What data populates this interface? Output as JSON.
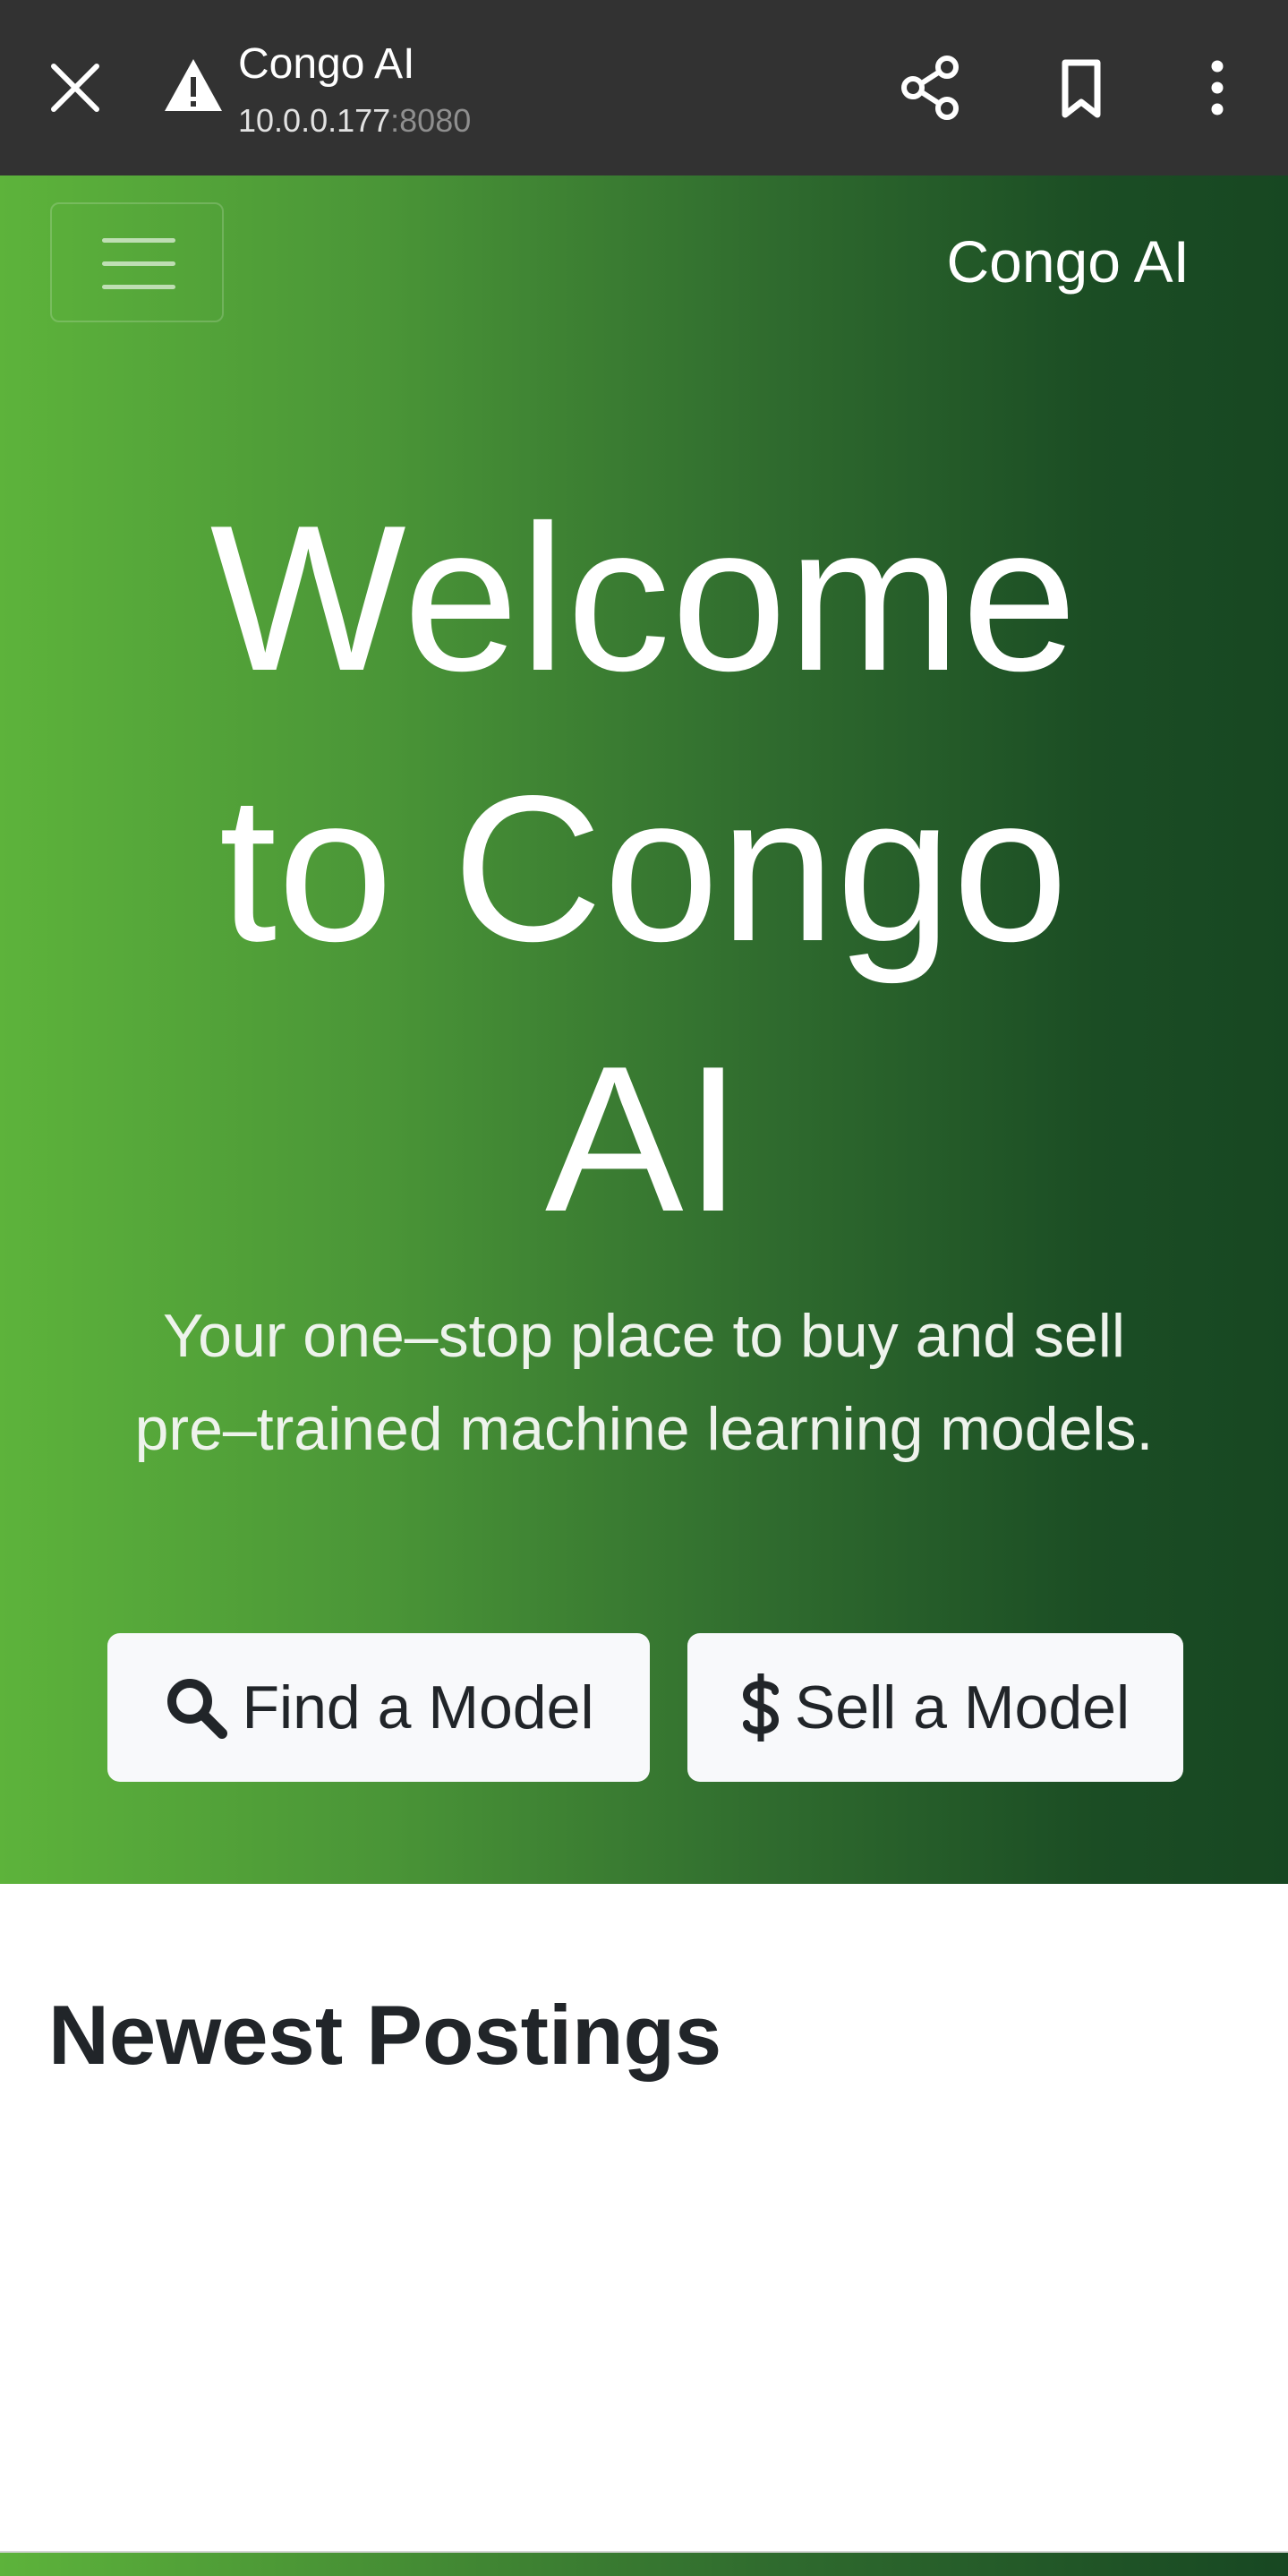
{
  "browser": {
    "tab_title": "Congo AI",
    "url_host": "10.0.0.177",
    "url_port": ":8080",
    "icons": [
      "close-icon",
      "warning-icon",
      "share-icon",
      "bookmark-icon",
      "more-vert-icon"
    ]
  },
  "navbar": {
    "brand": "Congo AI",
    "menu_icon": "hamburger-icon"
  },
  "hero": {
    "heading_light": "Welcome to",
    "heading_strong": "Congo AI",
    "subtitle": "Your one–stop place to buy and sell pre–trained machine learning models.",
    "find_button": {
      "label": "Find a Model",
      "icon": "search-icon"
    },
    "sell_button": {
      "label": "Sell a Model",
      "icon": "dollar-icon"
    },
    "gradient_colors": [
      "#5db33b",
      "#174722"
    ]
  },
  "content": {
    "section_title": "Newest Postings"
  }
}
